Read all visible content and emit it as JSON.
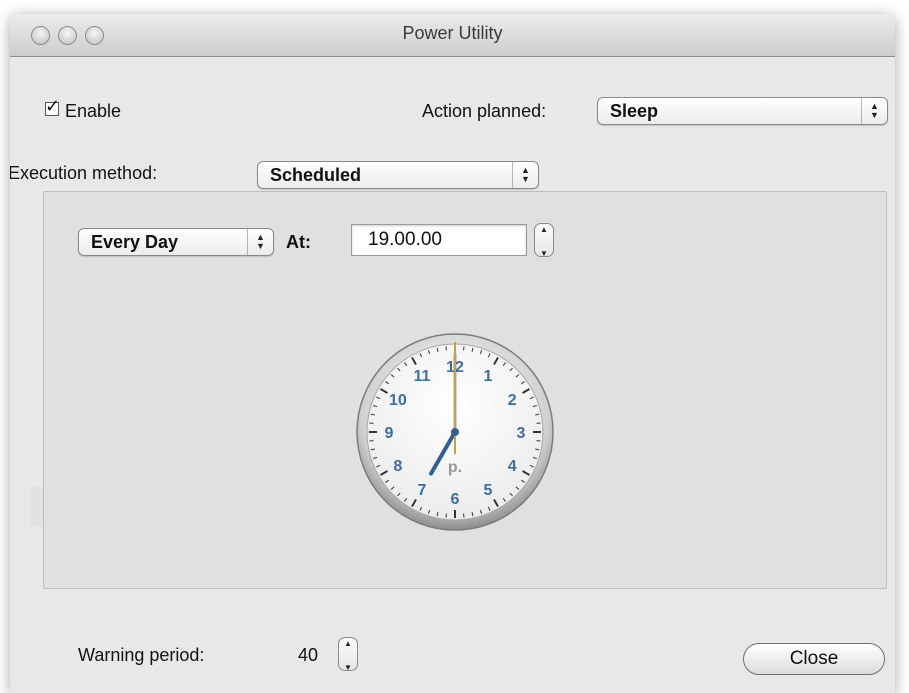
{
  "window": {
    "title": "Power Utility"
  },
  "enable": {
    "label": "Enable",
    "checked": true
  },
  "action": {
    "label": "Action planned:",
    "selected": "Sleep"
  },
  "execution": {
    "label": "Execution method:",
    "selected": "Scheduled"
  },
  "schedule": {
    "repeat_selected": "Every Day",
    "at_label": "At:",
    "time_value": "19.00.00"
  },
  "clock": {
    "numbers": [
      "12",
      "1",
      "2",
      "3",
      "4",
      "5",
      "6",
      "7",
      "8",
      "9",
      "10",
      "11"
    ],
    "period": "p.",
    "hour": 7,
    "minute": 0,
    "second": 0
  },
  "warning": {
    "label": "Warning period:",
    "value": "40"
  },
  "close_button": {
    "label": "Close"
  },
  "colors": {
    "clock_numbers": "#3a6fa6",
    "hour_hand": "#2f5f97",
    "second_hand": "#c8a04c"
  },
  "icons": {
    "enable_checkbox": "checkmark-icon",
    "popup_arrows": "updown-arrows-icon"
  }
}
